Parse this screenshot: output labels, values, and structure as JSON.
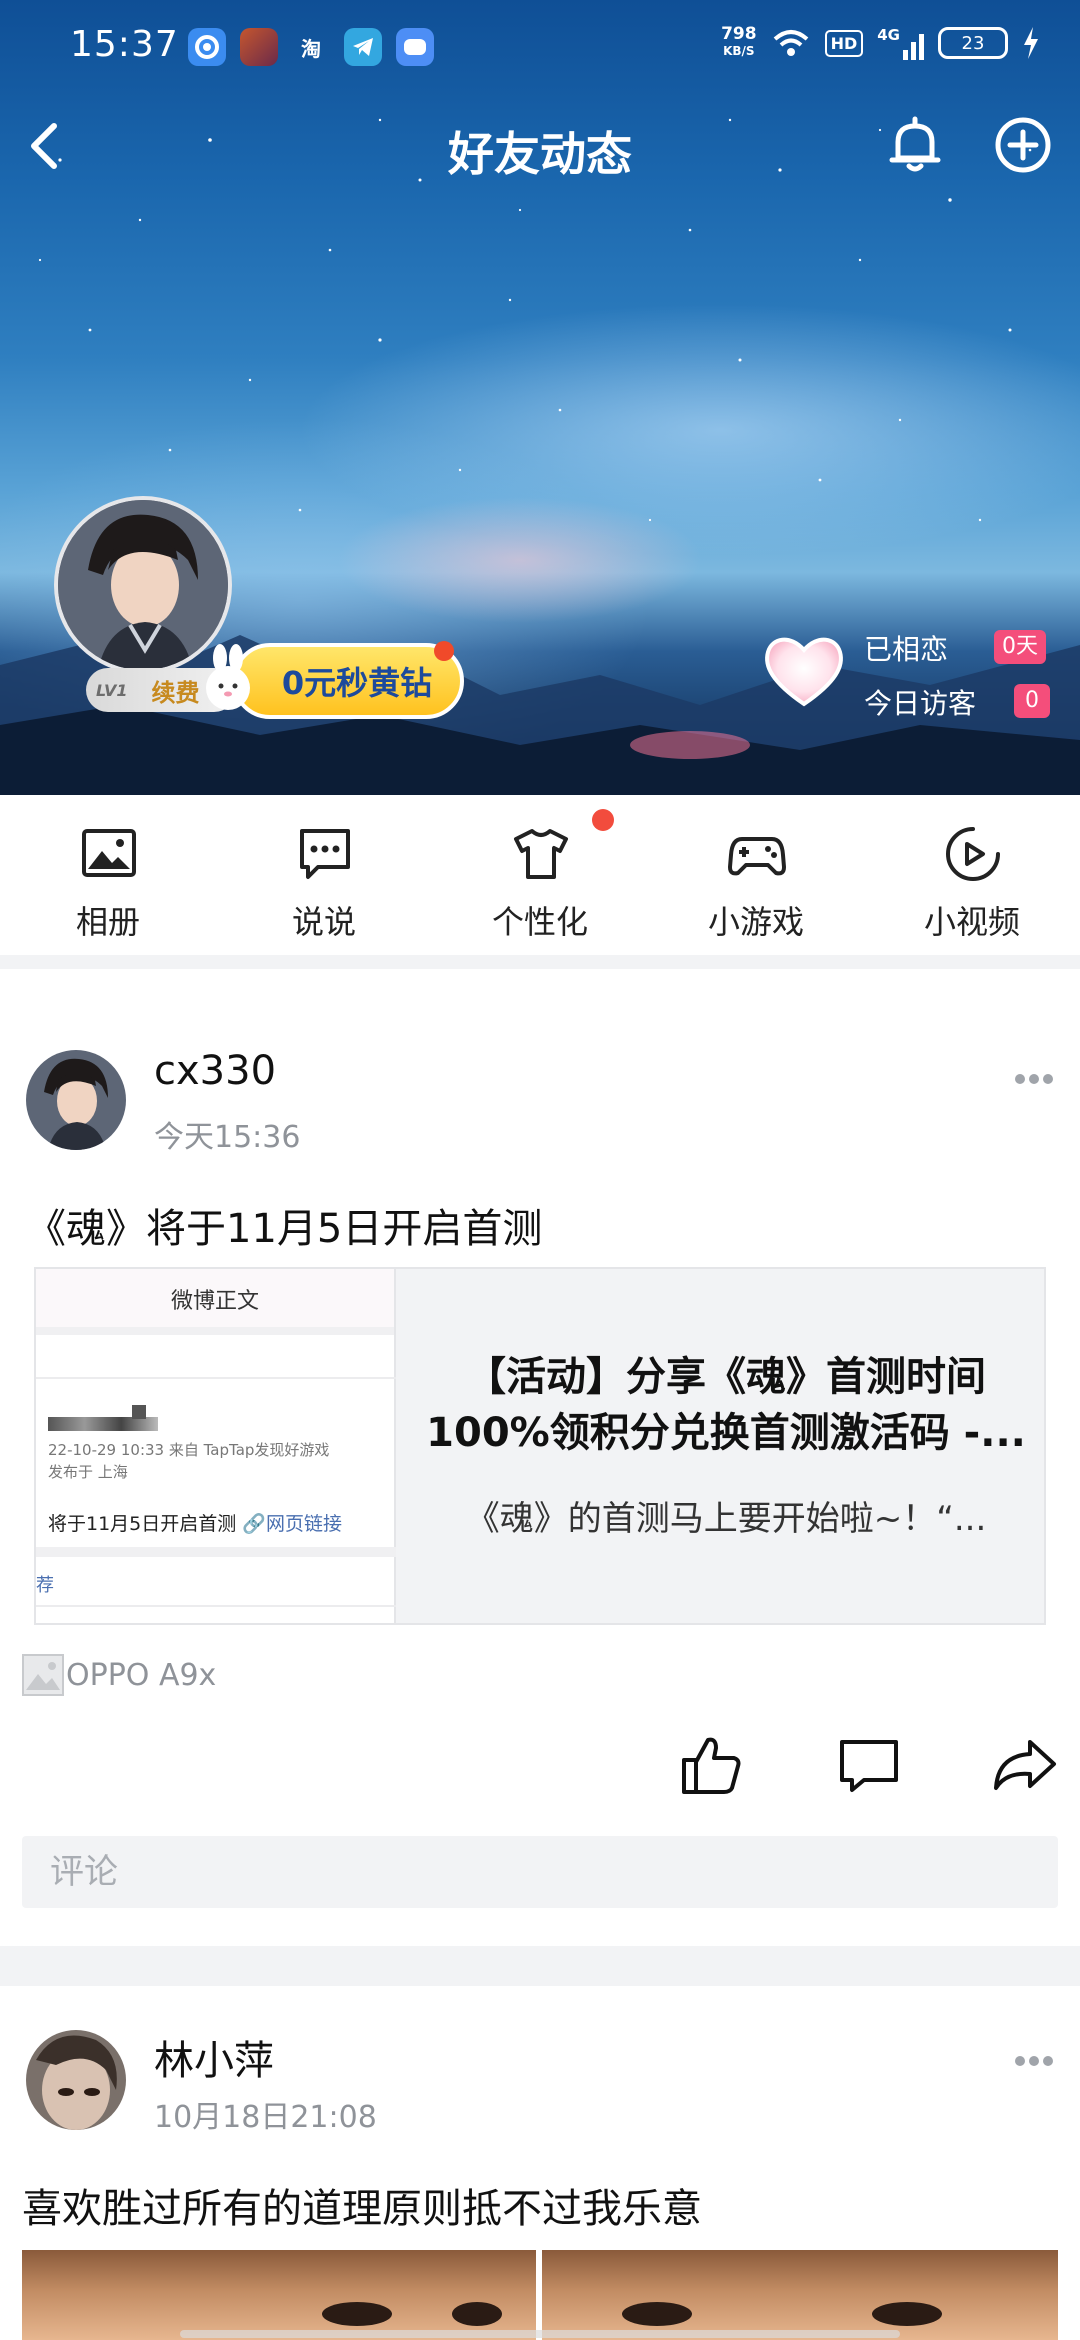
{
  "status_bar": {
    "time": "15:37",
    "net_speed_value": "798",
    "net_speed_unit": "KB/S",
    "hd_label": "HD",
    "signal_label": "4G",
    "battery": "23",
    "app_icon_taobao": "淘"
  },
  "header": {
    "title": "好友动态"
  },
  "profile": {
    "level_label": "LV1",
    "renew_label": "续费",
    "vip_promo": "0元秒黄钻",
    "relationship_label": "已相恋",
    "relationship_value": "0天",
    "visitors_label": "今日访客",
    "visitors_value": "0"
  },
  "icon_nav": {
    "items": [
      {
        "label": "相册",
        "icon": "album-icon"
      },
      {
        "label": "说说",
        "icon": "message-icon"
      },
      {
        "label": "个性化",
        "icon": "tshirt-icon"
      },
      {
        "label": "小游戏",
        "icon": "gamepad-icon"
      },
      {
        "label": "小视频",
        "icon": "play-icon"
      }
    ]
  },
  "posts": [
    {
      "user": "cx330",
      "time": "今天15:36",
      "text": "《魂》将于11月5日开启首测",
      "share": {
        "thumb_header": "微博正文",
        "thumb_meta_1": "22-10-29 10:33  来自 TapTap发现好游戏",
        "thumb_meta_2": "发布于 上海",
        "thumb_body": "将于11月5日开启首测",
        "thumb_link": "🔗网页链接",
        "thumb_footer": "荐",
        "title_line1": "【活动】分享《魂》首测时间",
        "title_line2": "100%领积分兑换首测激活码 -...",
        "description": "《魂》的首测马上要开始啦~！“..."
      },
      "device": "OPPO A9x",
      "comment_placeholder": "评论"
    },
    {
      "user": "林小萍",
      "time": "10月18日21:08",
      "text": "喜欢胜过所有的道理原则抵不过我乐意"
    }
  ],
  "colors": {
    "badge_pink": "#f44e7b",
    "notify_red": "#f24c3d",
    "vip_yellow": "#ffd23f",
    "muted_text": "#8f9399"
  }
}
